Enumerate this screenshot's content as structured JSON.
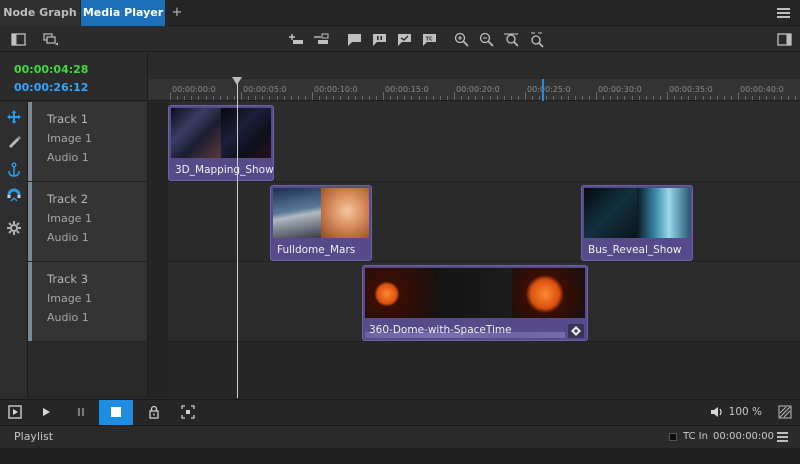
{
  "tabs": [
    {
      "label": "Node Graph",
      "active": false
    },
    {
      "label": "Media Player",
      "active": true
    }
  ],
  "add_tab_label": "+",
  "timecode": {
    "current": "00:00:04:28",
    "duration": "00:00:26:12"
  },
  "ruler": {
    "labels": [
      "00:00:00:0",
      "00:00:05:0",
      "00:00:10:0",
      "00:00:15:0",
      "00:00:20:0",
      "00:00:25:0",
      "00:00:30:0",
      "00:00:35:0",
      "00:00:40:0"
    ]
  },
  "tracks": [
    {
      "name": "Track 1",
      "image": "Image 1",
      "audio": "Audio 1"
    },
    {
      "name": "Track 2",
      "image": "Image 1",
      "audio": "Audio 1"
    },
    {
      "name": "Track 3",
      "image": "Image 1",
      "audio": "Audio 1"
    }
  ],
  "clips": [
    {
      "name": "3D_Mapping_Show",
      "track": 1
    },
    {
      "name": "Fulldome_Mars",
      "track": 2
    },
    {
      "name": "Bus_Reveal_Show",
      "track": 2
    },
    {
      "name": "360-Dome-with-SpaceTime",
      "track": 3
    }
  ],
  "transport": {
    "volume": "100 %"
  },
  "status": {
    "playlist": "Playlist",
    "tc_in_label": "TC In",
    "tc_in_value": "00:00:00:00"
  },
  "colors": {
    "accent": "#1d6fb8",
    "tc_current": "#3fdc3f",
    "tc_duration": "#33a6ff",
    "clip": "#564a8a"
  }
}
